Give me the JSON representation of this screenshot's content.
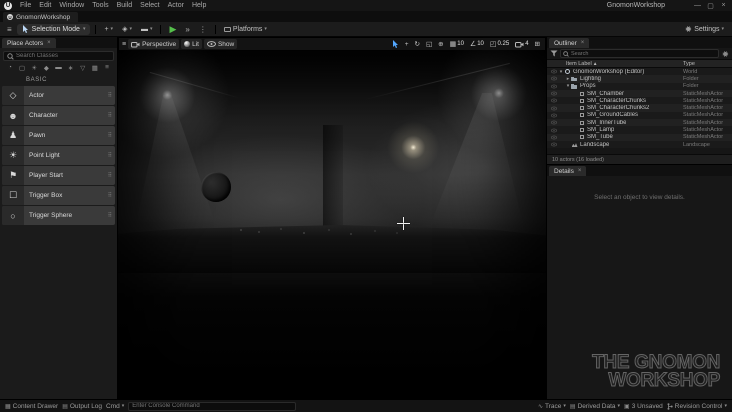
{
  "window": {
    "title": "GnomonWorkshop",
    "menu": [
      "File",
      "Edit",
      "Window",
      "Tools",
      "Build",
      "Select",
      "Actor",
      "Help"
    ],
    "logo_letter": "U"
  },
  "tabs": {
    "project_tab": "GnomonWorkshop"
  },
  "toolbar": {
    "selection_mode": "Selection Mode",
    "platforms": "Platforms",
    "settings": "Settings"
  },
  "place_actors": {
    "title": "Place Actors",
    "search_placeholder": "Search Classes",
    "category": "BASIC",
    "categories": [
      {
        "glyph": "◔"
      },
      {
        "glyph": "▢"
      },
      {
        "glyph": "☀"
      },
      {
        "glyph": "◆"
      },
      {
        "glyph": "▬"
      },
      {
        "glyph": "∗"
      },
      {
        "glyph": "▽"
      },
      {
        "glyph": "▦"
      },
      {
        "glyph": "≡"
      }
    ],
    "items": [
      {
        "label": "Actor",
        "glyph": "◇"
      },
      {
        "label": "Character",
        "glyph": "☻"
      },
      {
        "label": "Pawn",
        "glyph": "♟"
      },
      {
        "label": "Point Light",
        "glyph": "☀"
      },
      {
        "label": "Player Start",
        "glyph": "⚑"
      },
      {
        "label": "Trigger Box",
        "glyph": "☐"
      },
      {
        "label": "Trigger Sphere",
        "glyph": "○"
      }
    ]
  },
  "viewport": {
    "perspective": "Perspective",
    "lit": "Lit",
    "show": "Show",
    "grid_snap": "10",
    "rotation_snap": "10",
    "scale_snap": "0.25",
    "camera_speed": "4"
  },
  "outliner": {
    "title": "Outliner",
    "search_placeholder": "Search",
    "columns": {
      "label": "Item Label",
      "type": "Type"
    },
    "rows": [
      {
        "label": "GnomonWorkshop (Editor)",
        "type": "World",
        "kind": "world",
        "caret": "down",
        "indent": 0
      },
      {
        "label": "Lighting",
        "type": "Folder",
        "kind": "folder",
        "caret": "right",
        "indent": 1
      },
      {
        "label": "Props",
        "type": "Folder",
        "kind": "folder",
        "caret": "down",
        "indent": 1
      },
      {
        "label": "SM_Chamber",
        "type": "StaticMeshActor",
        "kind": "mesh",
        "caret": "",
        "indent": 2
      },
      {
        "label": "SM_CharacterChunks",
        "type": "StaticMeshActor",
        "kind": "mesh",
        "caret": "",
        "indent": 2
      },
      {
        "label": "SM_CharacterChunks2",
        "type": "StaticMeshActor",
        "kind": "mesh",
        "caret": "",
        "indent": 2
      },
      {
        "label": "SM_GroundCables",
        "type": "StaticMeshActor",
        "kind": "mesh",
        "caret": "",
        "indent": 2
      },
      {
        "label": "SM_InnerTube",
        "type": "StaticMeshActor",
        "kind": "mesh",
        "caret": "",
        "indent": 2
      },
      {
        "label": "SM_Lamp",
        "type": "StaticMeshActor",
        "kind": "mesh",
        "caret": "",
        "indent": 2
      },
      {
        "label": "SM_Tube",
        "type": "StaticMeshActor",
        "kind": "mesh",
        "caret": "",
        "indent": 2
      },
      {
        "label": "Landscape",
        "type": "Landscape",
        "kind": "landscape",
        "caret": "",
        "indent": 1
      }
    ],
    "footer": "10 actors (16 loaded)"
  },
  "details": {
    "title": "Details",
    "empty_message": "Select an object to view details."
  },
  "status_bar": {
    "content_drawer": "Content Drawer",
    "output_log": "Output Log",
    "cmd": "Cmd",
    "console_placeholder": "Enter Console Command",
    "trace": "Trace",
    "derived_data": "Derived Data",
    "unsaved": "3 Unsaved",
    "revision_control": "Revision Control"
  },
  "watermark": {
    "line1": "THE GNOMON",
    "line2": "WORKSHOP"
  },
  "icons": {
    "hamburger": "≡",
    "caret_down": "▾",
    "close": "×",
    "minimize": "—",
    "maximize": "▢",
    "play": "▶",
    "skip": "»",
    "kebab": "⋮",
    "grip": "⠿",
    "sort_asc": "▴",
    "add": "+",
    "blueprint": "◈",
    "cinematics": "▬",
    "move_tool": "+",
    "rotate_tool": "↻",
    "scale_tool": "◱",
    "world": "⊕",
    "grid": "▦",
    "angle": "∠",
    "scale_snap": "◰",
    "viewport_maximize": "⊞",
    "trace": "∿",
    "derived": "▤",
    "unsaved": "▣",
    "content_drawer": "▦",
    "output_log": "▤"
  },
  "colors": {
    "accent": "#0070e0",
    "play_green": "#55c04b"
  }
}
